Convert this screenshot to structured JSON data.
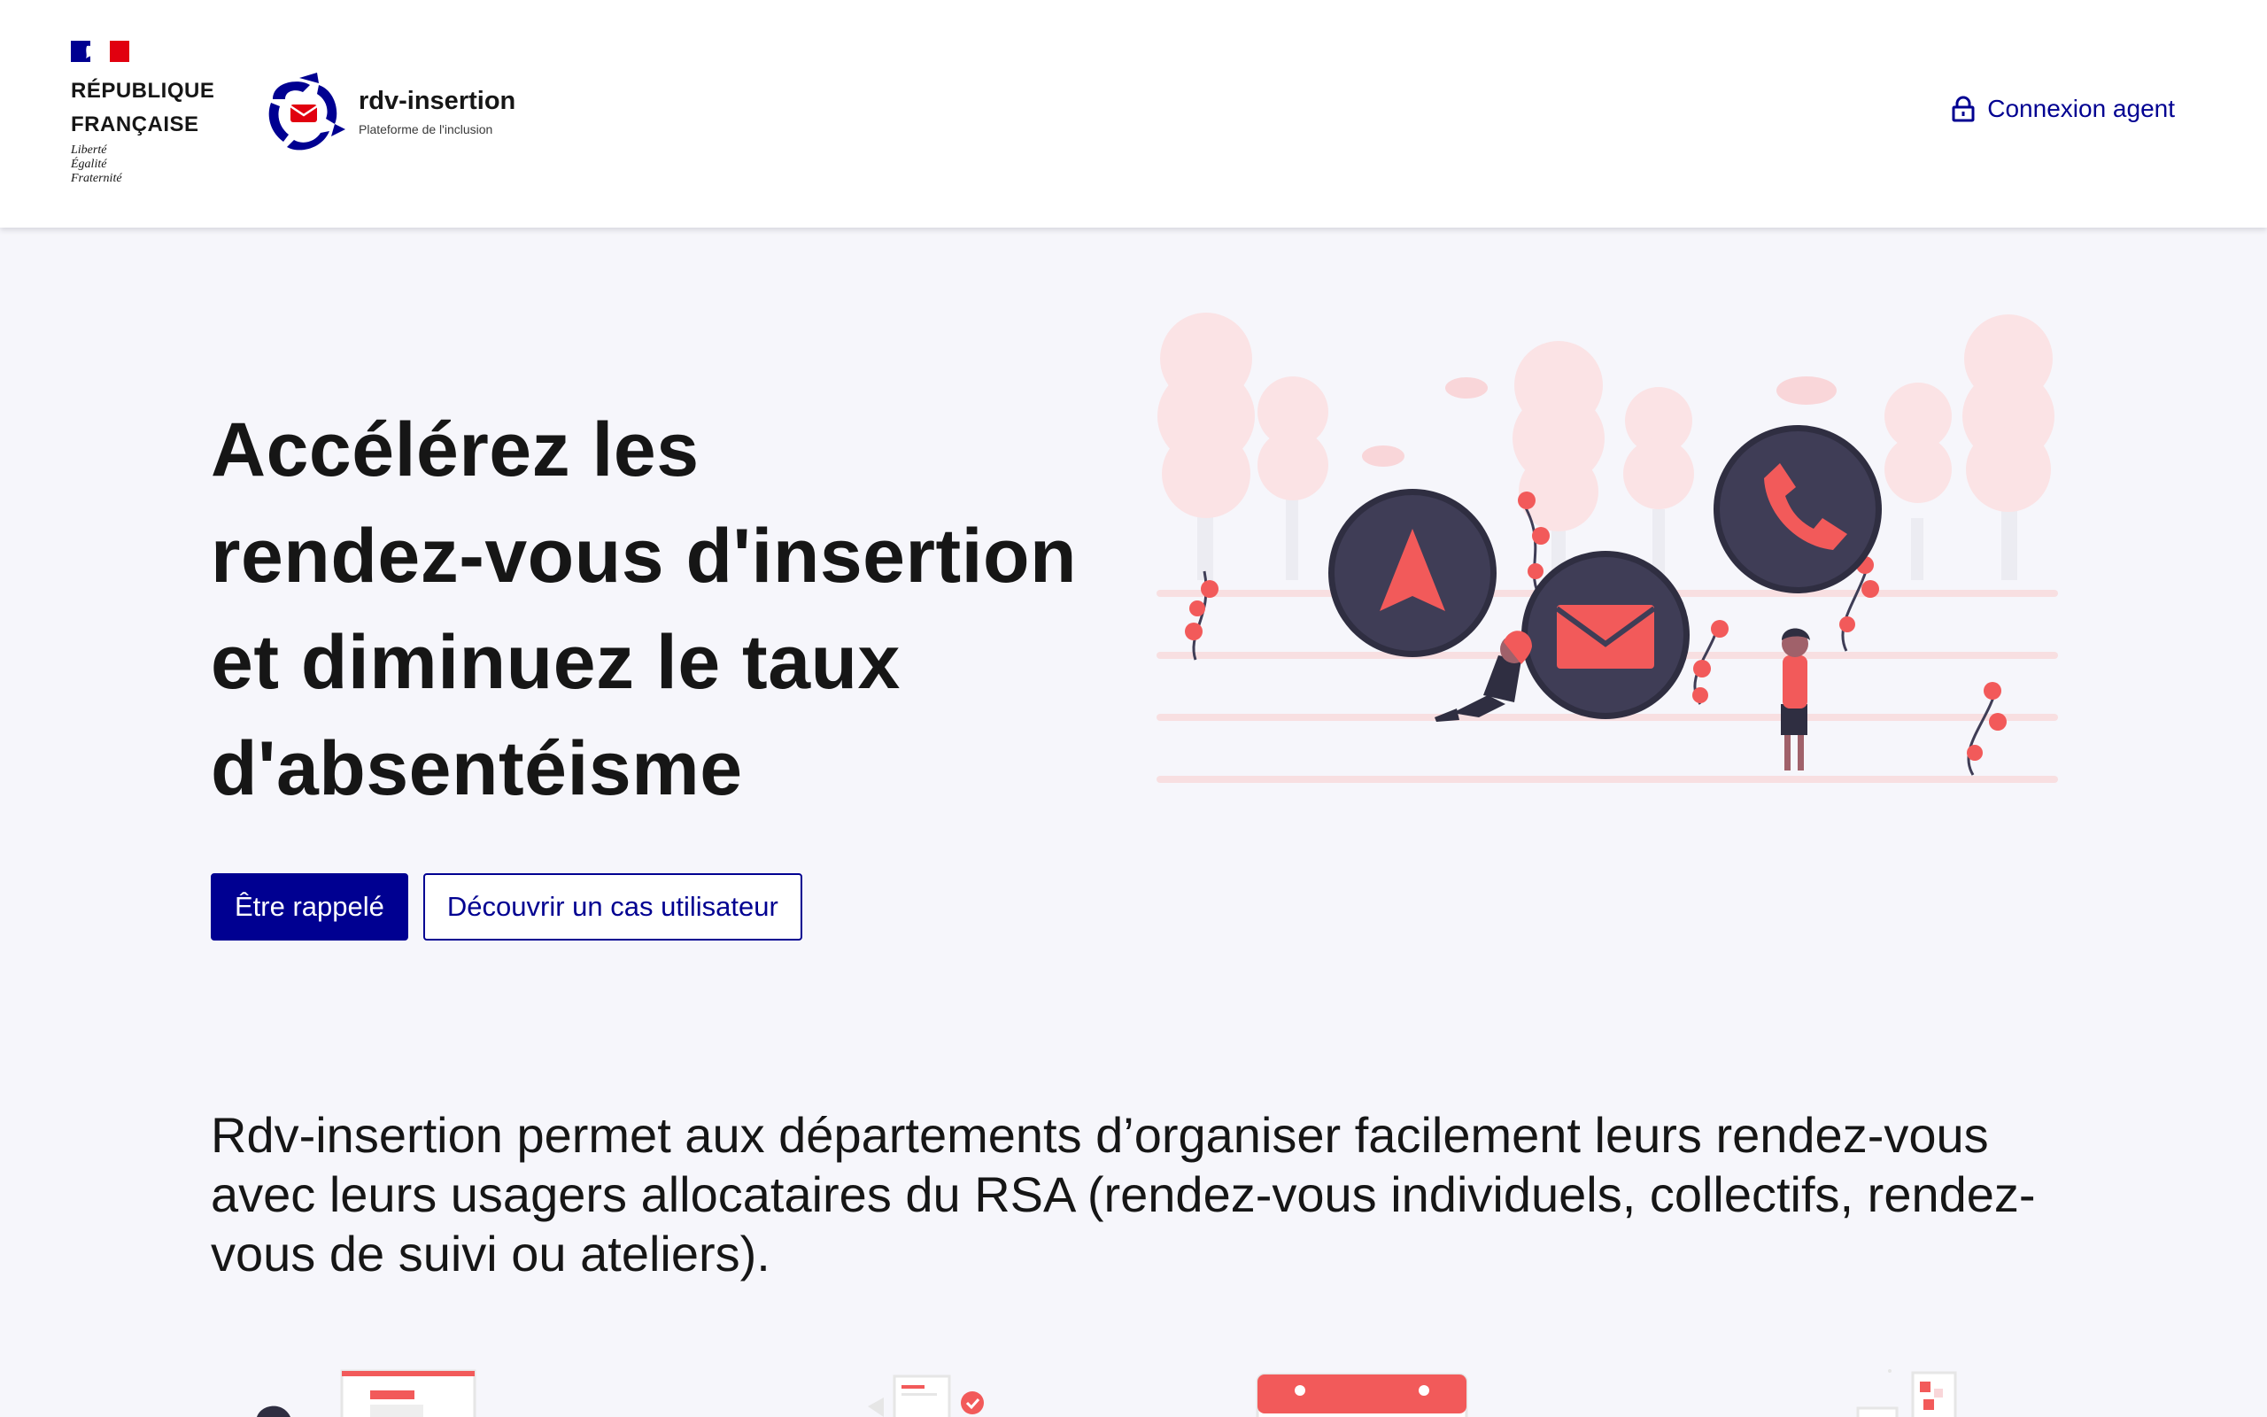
{
  "header": {
    "gov_name_line1": "RÉPUBLIQUE",
    "gov_name_line2": "FRANÇAISE",
    "motto_line1": "Liberté",
    "motto_line2": "Égalité",
    "motto_line3": "Fraternité",
    "brand_name": "rdv-insertion",
    "brand_tagline": "Plateforme de l'inclusion",
    "login_label": "Connexion agent"
  },
  "hero": {
    "title_lines": [
      "Accélérez les",
      "rendez-vous d'insertion",
      "et diminuez le taux",
      "d'absentéisme"
    ],
    "primary_cta": "Être rappelé",
    "secondary_cta": "Découvrir un cas utilisateur"
  },
  "intro": {
    "text": "Rdv-insertion permet aux départements d’organiser facilement leurs rendez-vous avec leurs usagers allocataires du RSA (rendez-vous individuels, collectifs, rendez-vous de suivi ou ateliers)."
  },
  "colors": {
    "primary": "#000091",
    "accent": "#f25a5a",
    "dark_circle": "#3f3d56",
    "blossom": "#f9d6d9",
    "ground": "#f8dfe1"
  },
  "icons": {
    "login": "lock-icon",
    "hero_circles": [
      "navigation-arrow-icon",
      "envelope-icon",
      "phone-icon"
    ]
  }
}
